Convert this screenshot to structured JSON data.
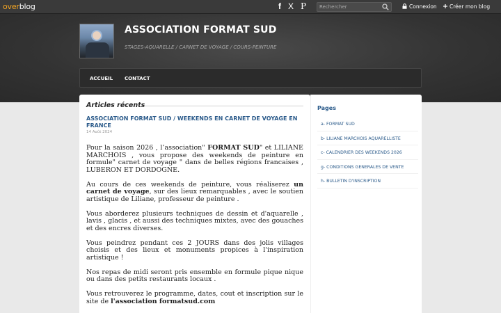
{
  "topbar": {
    "logo_left": "over",
    "logo_right": "blog",
    "social": {
      "facebook": "f",
      "x": "X",
      "pinterest": "P"
    },
    "search_placeholder": "Rechercher",
    "login": "Connexion",
    "create_blog": "Créer mon blog"
  },
  "header": {
    "title": "ASSOCIATION FORMAT SUD",
    "subtitle": "STAGES-AQUARELLE / CARNET DE VOYAGE / COURS-PEINTURE"
  },
  "nav": {
    "items": [
      "ACCUEIL",
      "CONTACT"
    ]
  },
  "main": {
    "section_title": "Articles récents",
    "article": {
      "title": "ASSOCIATION FORMAT SUD / WEEKENDS EN CARNET DE VOYAGE EN FRANCE",
      "date": "14 Août 2024",
      "p1_a": "Pour la saison 2026 , l’association\" ",
      "p1_b": "FORMAT SUD",
      "p1_c": "\" et LILIANE MARCHOIS , vous propose des weekends de peinture en formule\" carnet de voyage \" dans de belles régions francaises , LUBERON ET DORDOGNE.",
      "p2_a": "Au cours de ces weekends de peinture, vous réaliserez ",
      "p2_b": "un carnet de voyage",
      "p2_c": ", sur des lieux remarquables , avec le soutien artistique de Liliane, professeur de peinture .",
      "p3": "Vous aborderez plusieurs techniques de dessin et d'aquarelle , lavis , glacis , et aussi des techniques mixtes, avec des gouaches et des encres diverses.",
      "p4": "Vous peindrez pendant ces 2 JOURS dans des jolis villages choisis et des lieux et monuments propices à l'inspiration artistique !",
      "p5": "Nos repas de midi seront pris ensemble en formule pique nique ou dans des petits restaurants locaux .",
      "p6_a": "Vous retrouverez le programme, dates, cout et inscription sur le site de ",
      "p6_b": "l'association formatsud.com"
    }
  },
  "sidebar": {
    "title": "Pages",
    "items": [
      "a- FORMAT SUD",
      "b- LILIANE MARCHOIS AQUARELLISTE",
      "c- CALENDRIER DES WEEKENDS 2026",
      "g- CONDITIONS GENERALES DE VENTE",
      "h- BULLETIN D'INSCRIPTION"
    ]
  },
  "colors": {
    "accent": "#2a5a8a",
    "logo_accent": "#f5a623",
    "topbar": "#3a3a3a"
  }
}
